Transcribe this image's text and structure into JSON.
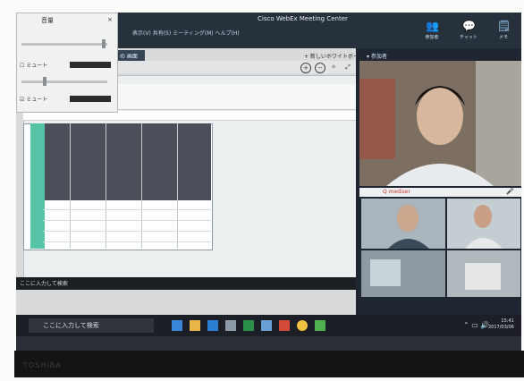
{
  "window": {
    "title": "Cisco WebEx Meeting Center"
  },
  "menu": {
    "items": "表示(V) 共有(S) ミーティング(M) ヘルプ(H)"
  },
  "ribbon_buttons": [
    {
      "label": "参加者",
      "icon": "participants-icon"
    },
    {
      "label": "チャット",
      "icon": "chat-icon"
    },
    {
      "label": "メモ",
      "icon": "notes-icon"
    }
  ],
  "content": {
    "tab_label": "の 画面",
    "new_whiteboard": "+ 新しいホワイトボード"
  },
  "popup": {
    "title": "音量",
    "close": "×",
    "options": [
      {
        "label": "☐ ミュート"
      },
      {
        "label": "☑ ミュート"
      }
    ]
  },
  "participants": {
    "header": "▾ 参加者",
    "strip_label": "Q  mediser",
    "mute_icon": "mic-mute-icon"
  },
  "remote_taskbar": {
    "search_text": "ここに入力して検索"
  },
  "taskbar": {
    "search_text": "ここに入力して検索",
    "clock_time": "15:41",
    "clock_date": "2017/03/06"
  },
  "bezel": {
    "brand": "TOSHIBA"
  },
  "colors": {
    "accent": "#56c3a6",
    "titlebar": "#26313c",
    "taskbar": "#1c1f25"
  }
}
